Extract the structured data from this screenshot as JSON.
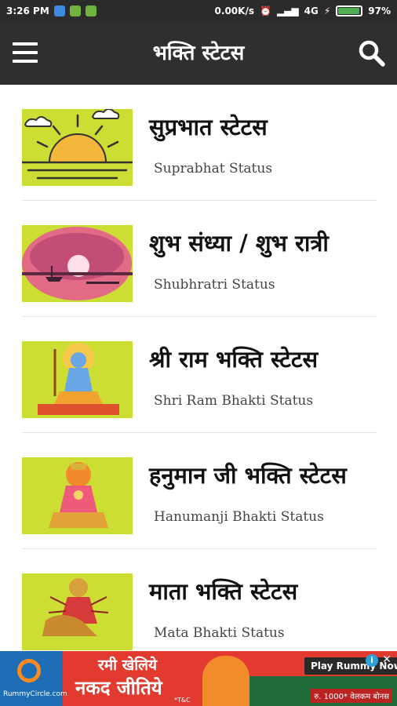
{
  "statusbar": {
    "time": "3:26 PM",
    "speed": "0.00K/s",
    "network": "4G",
    "battery": "97%",
    "battery_level": 0.97
  },
  "appbar": {
    "title": "भक्ति स्टेटस",
    "menu_icon": "hamburger-menu-icon",
    "search_icon": "search-icon"
  },
  "categories": [
    {
      "title": "सुप्रभात स्टेटस",
      "subtitle": "Suprabhat Status",
      "thumb": "sunrise"
    },
    {
      "title": "शुभ संध्या / शुभ रात्री",
      "subtitle": "Shubhratri Status",
      "thumb": "sunset"
    },
    {
      "title": "श्री राम भक्ति स्टेटस",
      "subtitle": "Shri Ram Bhakti Status",
      "thumb": "ram"
    },
    {
      "title": "हनुमान जी भक्ति स्टेटस",
      "subtitle": "Hanumanji Bhakti Status",
      "thumb": "hanuman"
    },
    {
      "title": "माता भक्ति स्टेटस",
      "subtitle": "Mata Bhakti Status",
      "thumb": "mata"
    }
  ],
  "ad": {
    "logo_text": "RummyCircle.com",
    "line1": "रमी खेलिये",
    "line2": "नकद जीतिये",
    "tc": "*T&C",
    "cta": "Play Rummy Now",
    "bonus": "रु. 1000* वेलकम बोनस",
    "info": "i",
    "close": "✕"
  },
  "colors": {
    "appbar": "#2f2f2f",
    "thumb_bg": "#ccdd33",
    "ad_bg": "#e23a2f"
  }
}
